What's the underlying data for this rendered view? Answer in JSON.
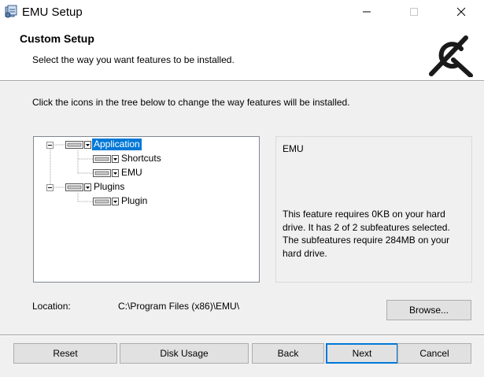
{
  "window": {
    "title": "EMU Setup"
  },
  "header": {
    "title": "Custom Setup",
    "subtitle": "Select the way you want features to be installed."
  },
  "instruction": "Click the icons in the tree below to change the way features will be installed.",
  "tree": {
    "nodes": [
      {
        "label": "Application",
        "selected": true
      },
      {
        "label": "Shortcuts"
      },
      {
        "label": "EMU"
      },
      {
        "label": "Plugins"
      },
      {
        "label": "Plugin"
      }
    ]
  },
  "description": {
    "title": "EMU",
    "body": "This feature requires 0KB on your hard drive. It has 2 of 2 subfeatures selected. The subfeatures require 284MB on your hard drive."
  },
  "location": {
    "label": "Location:",
    "value": "C:\\Program Files (x86)\\EMU\\"
  },
  "buttons": {
    "browse": "Browse...",
    "reset": "Reset",
    "disk_usage": "Disk Usage",
    "back": "Back",
    "next": "Next",
    "cancel": "Cancel"
  },
  "colors": {
    "selection": "#0078d7",
    "background": "#f0f0f0"
  }
}
